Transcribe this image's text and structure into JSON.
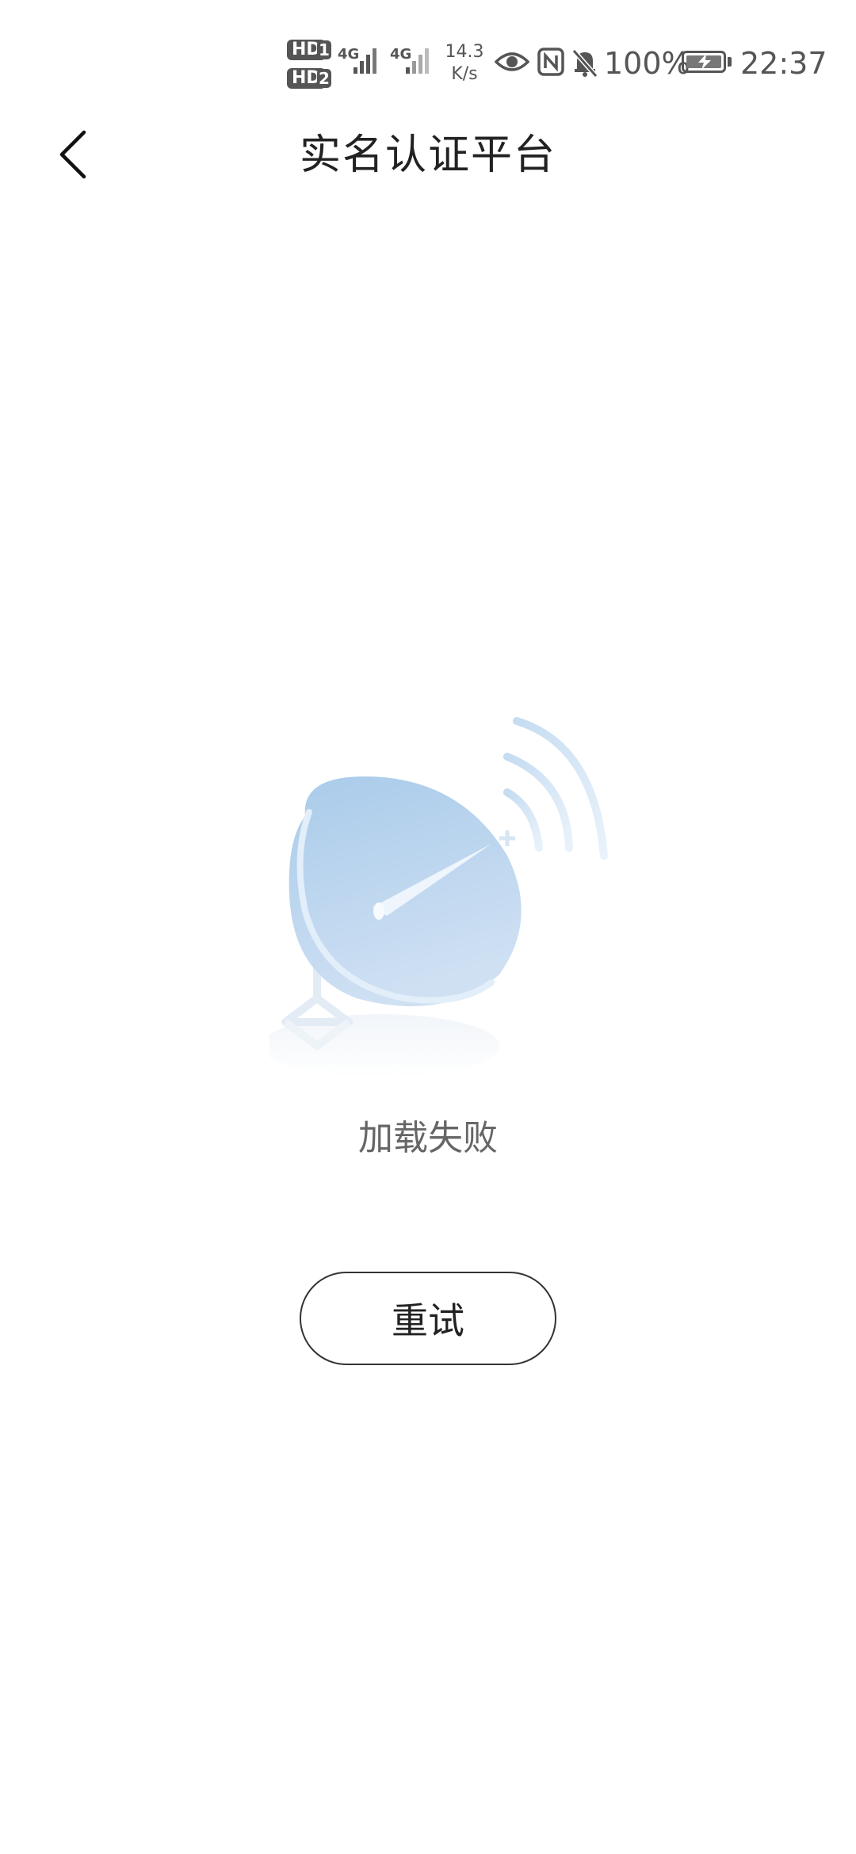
{
  "status_bar": {
    "sim1_label": "HD",
    "sim1_num": "1",
    "sim2_label": "HD",
    "sim2_num": "2",
    "network1": "4G",
    "network2": "4G",
    "speed_value": "14.3",
    "speed_unit": "K/s",
    "battery_percent": "100%",
    "time": "22:37",
    "icons": [
      "eye-icon",
      "nfc-icon",
      "bell-muted-icon",
      "battery-charging-icon",
      "signal-icon"
    ]
  },
  "header": {
    "title": "实名认证平台",
    "back_icon": "chevron-left-icon"
  },
  "empty_state": {
    "illustration": "satellite-dish-icon",
    "message": "加载失败",
    "retry_label": "重试"
  },
  "colors": {
    "dish_light": "#d6e6f5",
    "dish_dark": "#a9c9e8",
    "text_primary": "#222222",
    "text_secondary": "#666666"
  }
}
